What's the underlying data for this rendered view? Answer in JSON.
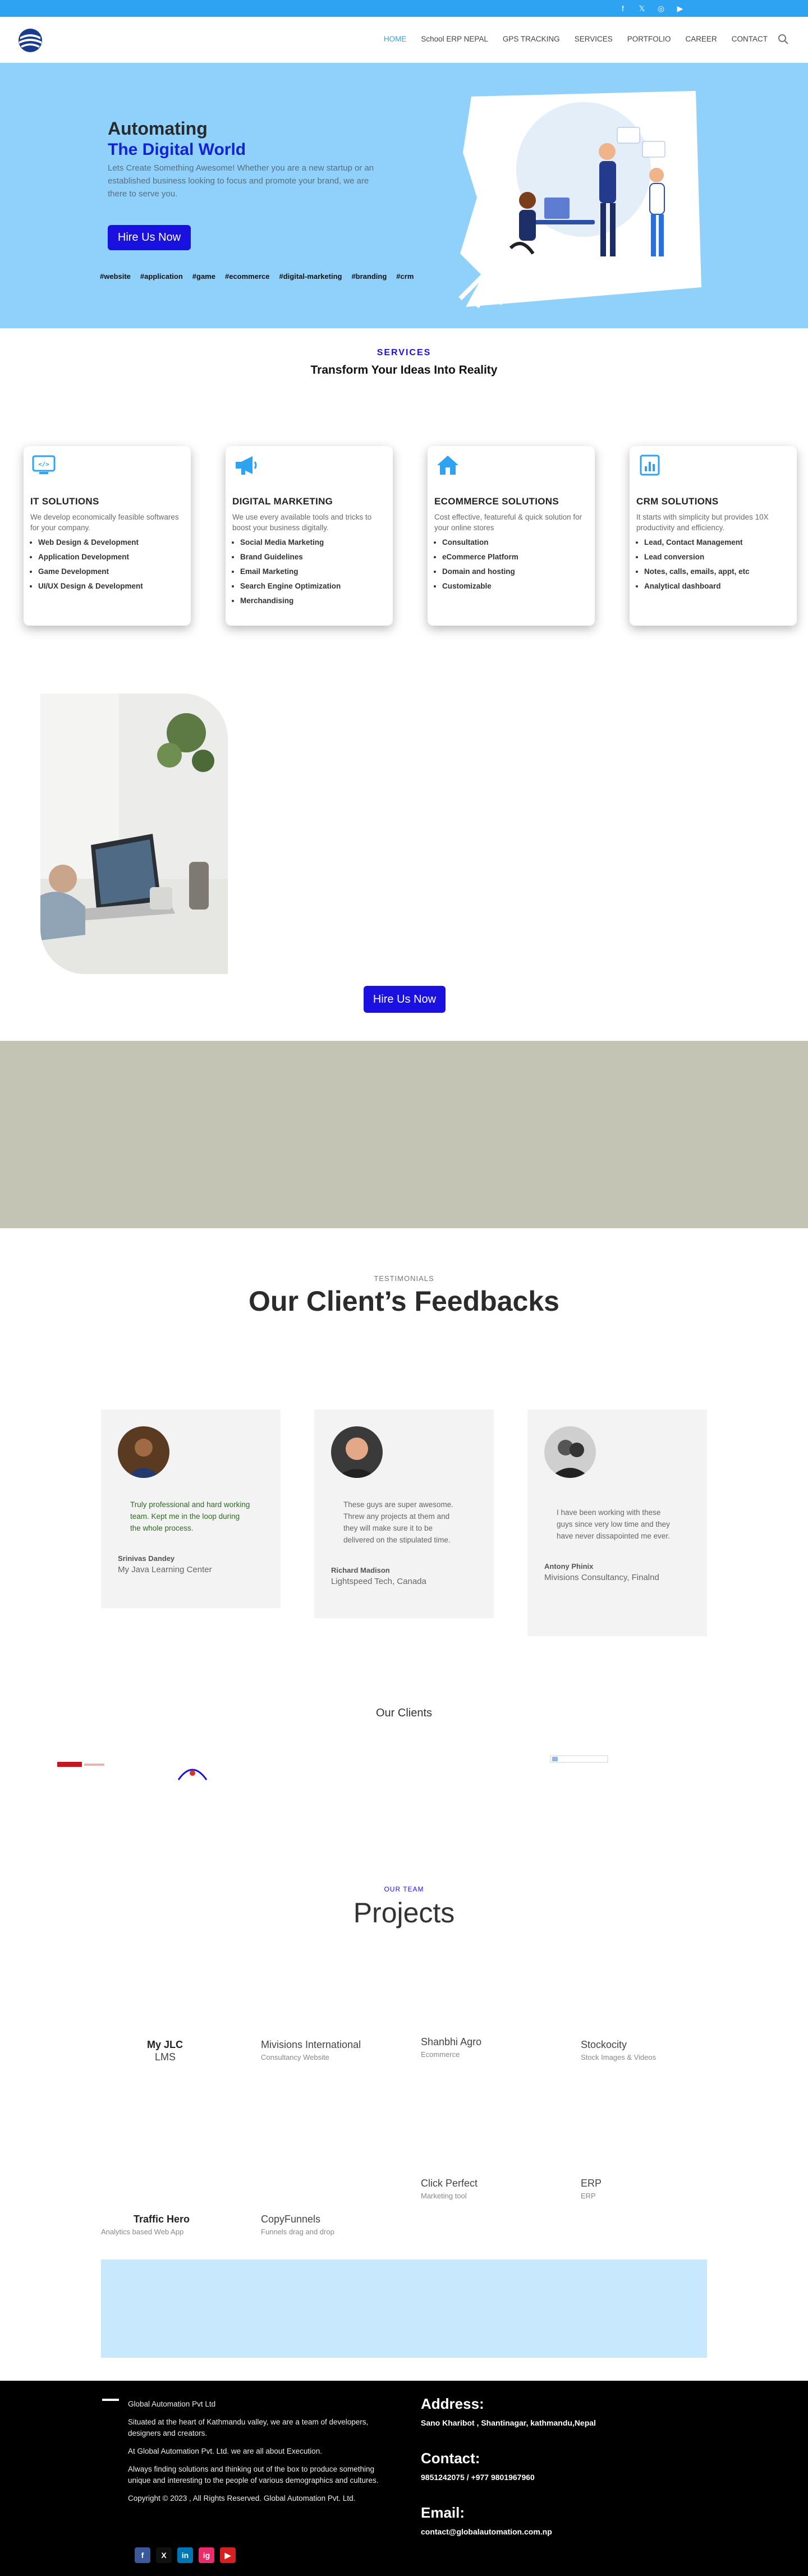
{
  "topbar": {
    "social_icons": [
      "facebook-icon",
      "x-icon",
      "instagram-icon",
      "youtube-icon"
    ],
    "color": "#2ea3f2"
  },
  "header": {
    "nav": [
      {
        "label": "HOME",
        "active": true
      },
      {
        "label": "School ERP NEPAL",
        "active": false
      },
      {
        "label": "GPS TRACKING",
        "active": false
      },
      {
        "label": "SERVICES",
        "active": false
      },
      {
        "label": "PORTFOLIO",
        "active": false
      },
      {
        "label": "CAREER",
        "active": false
      },
      {
        "label": "CONTACT",
        "active": false
      }
    ]
  },
  "hero": {
    "title_line1": "Automating",
    "title_line2": "The Digital World",
    "subtitle": "Lets Create Something Awesome! Whether you are a new startup or an established business looking to focus and promote your brand, we are there to serve you.",
    "cta": "Hire Us Now",
    "tags": [
      "#website",
      "#application",
      "#game",
      "#ecommerce",
      "#digital-marketing",
      "#branding",
      "#crm"
    ],
    "bg_color": "#8fd1fb",
    "accent": "#1322d6"
  },
  "services": {
    "kicker": "SERVICES",
    "title": "Transform Your Ideas Into Reality",
    "cards": [
      {
        "icon": "code-icon",
        "title": "IT SOLUTIONS",
        "desc": "We develop economically feasible softwares for your company.",
        "items": [
          "Web Design & Development",
          "Application Development",
          "Game Development",
          "UI/UX Design & Development"
        ]
      },
      {
        "icon": "megaphone-icon",
        "title": "DIGITAL MARKETING",
        "desc": "We use every available tools and tricks to boost your business digitally.",
        "items": [
          "Social Media Marketing",
          "Brand Guidelines",
          "Email Marketing",
          "Search Engine Optimization",
          "Merchandising"
        ]
      },
      {
        "icon": "home-icon",
        "title": "ECOMMERCE SOLUTIONS",
        "desc": "Cost effective, featureful & quick solution for your online stores",
        "items": [
          "Consultation",
          "eCommerce Platform",
          "Domain and hosting",
          "Customizable"
        ]
      },
      {
        "icon": "chart-icon",
        "title": "CRM SOLUTIONS",
        "desc": "It starts with simplicity but provides 10X productivity and efficiency.",
        "items": [
          "Lead, Contact Management",
          "Lead conversion",
          "Notes, calls, emails, appt, etc",
          "Analytical dashboard"
        ]
      }
    ]
  },
  "mid_cta": "Hire Us Now",
  "testimonials": {
    "kicker": "TESTIMONIALS",
    "title": "Our Client’s Feedbacks",
    "items": [
      {
        "quote": "Truly professional and hard working team. Kept me in the loop during the whole process.",
        "name": "Srinivas Dandey",
        "org": "My Java Learning Center"
      },
      {
        "quote": "These guys are super awesome. Threw any projects at them and they will make sure it to be delivered on the stipulated time.",
        "name": "Richard Madison",
        "org": "Lightspeed Tech, Canada"
      },
      {
        "quote": "I have been working with these guys since very low time and they have never dissapointed me ever.",
        "name": "Antony Phinix",
        "org": "Mivisions Consultancy, Finalnd"
      }
    ]
  },
  "clients": {
    "title": "Our Clients"
  },
  "projects": {
    "kicker": "OUR TEAM",
    "title": "Projects",
    "items": [
      {
        "name": "My JLC",
        "name2": "LMS",
        "desc": ""
      },
      {
        "name": "Mivisions International",
        "desc": "Consultancy Website"
      },
      {
        "name": "Shanbhi Agro",
        "desc": "Ecommerce"
      },
      {
        "name": "Stockocity",
        "desc": "Stock Images & Videos"
      },
      {
        "name": "Click Perfect",
        "desc": "Marketing tool"
      },
      {
        "name": "ERP",
        "desc": "ERP"
      },
      {
        "name": "Traffic Hero",
        "desc": "Analytics based Web App"
      },
      {
        "name": "CopyFunnels",
        "desc": "Funnels drag and drop"
      }
    ]
  },
  "footer": {
    "company": "Global Automation Pvt Ltd",
    "about1": "Situated at the heart of Kathmandu valley, we are a team of developers, designers and creators.",
    "about2": "At Global Automation Pvt. Ltd. we are all about Execution.",
    "about3": "Always finding solutions and thinking out of the box to produce something unique and interesting to the people of various demographics and cultures.",
    "copyright": "Copyright © 2023 , All Rights Reserved. Global Automation Pvt. Ltd.",
    "address_h": "Address:",
    "address": "Sano Kharibot , Shantinagar, kathmandu,Nepal",
    "contact_h": "Contact:",
    "contact": "9851242075 / +977 9801967960",
    "email_h": "Email:",
    "email": "contact@globalautomation.com.np",
    "social": [
      "f",
      "X",
      "in",
      "ig",
      "▶"
    ]
  }
}
